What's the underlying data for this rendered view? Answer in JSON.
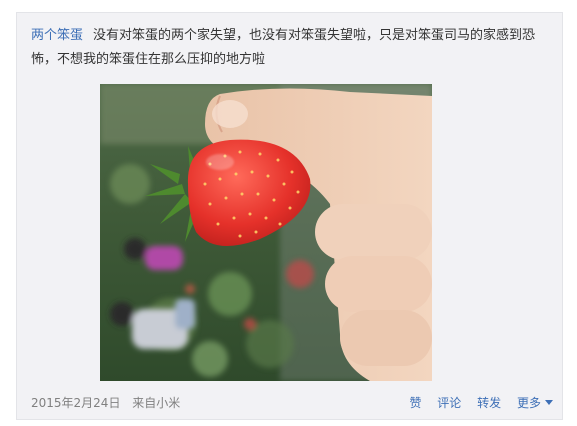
{
  "post": {
    "author": "两个笨蛋",
    "text": "没有对笨蛋的两个家失望，也没有对笨蛋失望啦，只是对笨蛋司马的家感到恐怖，不想我的笨蛋住在那么压抑的地方啦"
  },
  "footer": {
    "date": "2015年2月24日",
    "source": "来自小米",
    "like": "赞",
    "comment": "评论",
    "share": "转发",
    "more": "更多"
  },
  "colors": {
    "link": "#3d6fb6",
    "card_bg": "#f2f2f5",
    "meta_text": "#808080"
  }
}
